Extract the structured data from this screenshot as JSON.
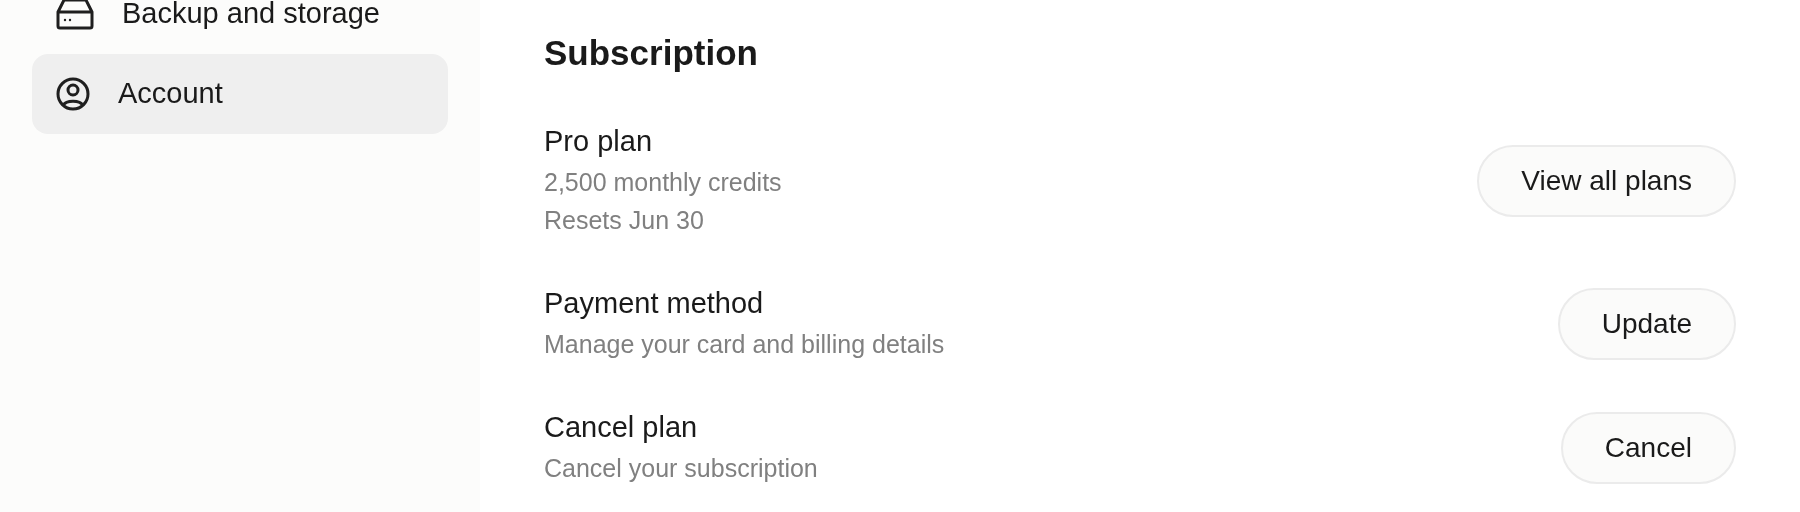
{
  "sidebar": {
    "items": [
      {
        "label": "Backup and storage",
        "kind": "drive",
        "selected": false
      },
      {
        "label": "Account",
        "kind": "user",
        "selected": true
      }
    ]
  },
  "main": {
    "heading": "Subscription",
    "rows": [
      {
        "title": "Pro plan",
        "lines": [
          "2,500 monthly credits",
          "Resets Jun 30"
        ],
        "button": "View all plans"
      },
      {
        "title": "Payment method",
        "lines": [
          "Manage your card and billing details"
        ],
        "button": "Update"
      },
      {
        "title": "Cancel plan",
        "lines": [
          "Cancel your subscription"
        ],
        "button": "Cancel"
      }
    ]
  }
}
